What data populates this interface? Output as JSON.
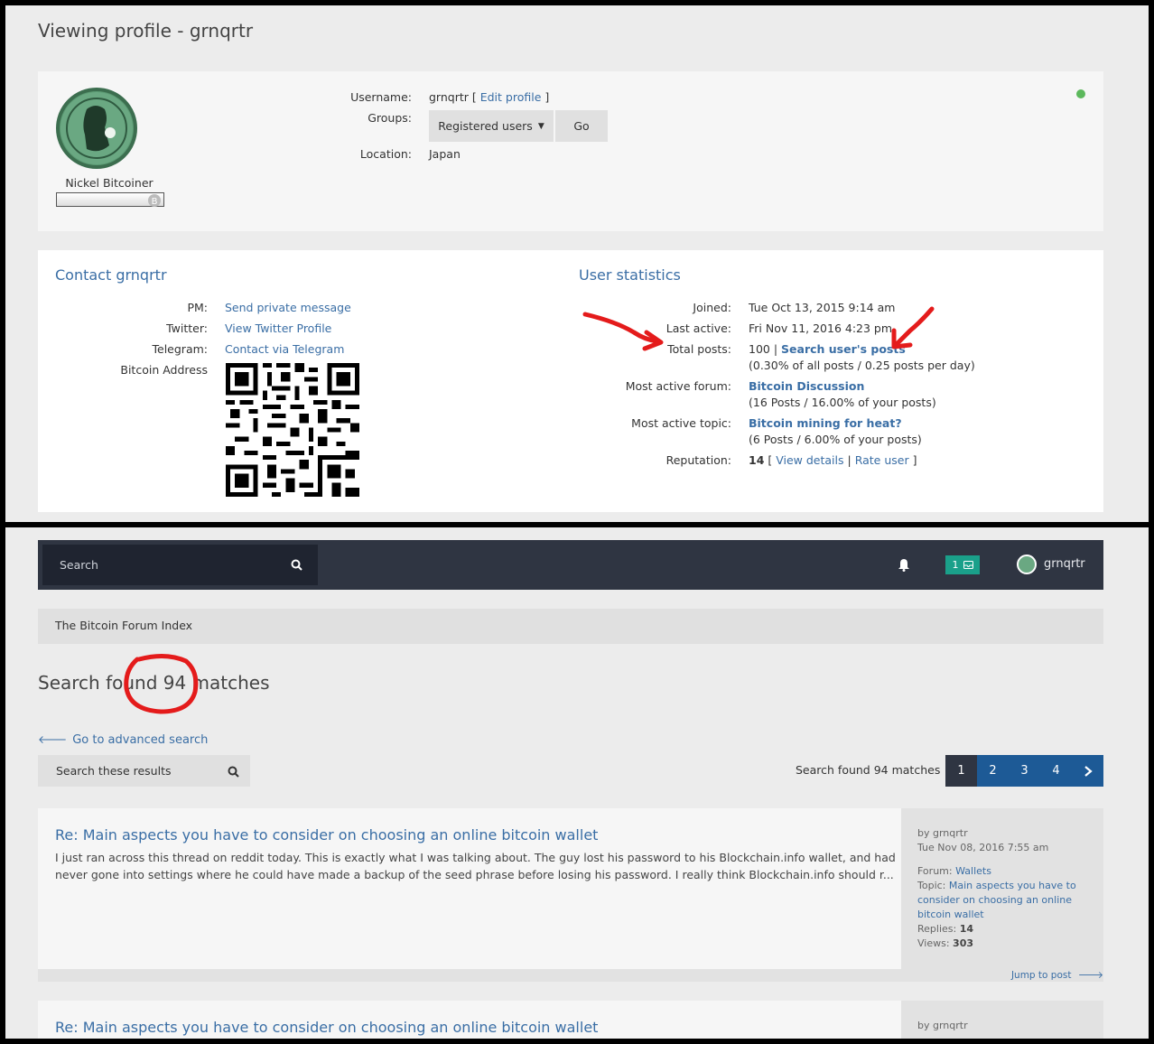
{
  "profile": {
    "title": "Viewing profile - grnqrtr",
    "rank": "Nickel Bitcoiner",
    "username_label": "Username:",
    "username": "grnqrtr",
    "edit_profile": "Edit profile",
    "groups_label": "Groups:",
    "group_selected": "Registered users",
    "go": "Go",
    "location_label": "Location:",
    "location": "Japan"
  },
  "contact": {
    "heading": "Contact grnqrtr",
    "pm_label": "PM:",
    "pm_link": "Send private message",
    "twitter_label": "Twitter:",
    "twitter_link": "View Twitter Profile",
    "telegram_label": "Telegram:",
    "telegram_link": "Contact via Telegram",
    "btc_label": "Bitcoin Address"
  },
  "stats": {
    "heading": "User statistics",
    "joined_label": "Joined:",
    "joined": "Tue Oct 13, 2015 9:14 am",
    "last_active_label": "Last active:",
    "last_active": "Fri Nov 11, 2016 4:23 pm",
    "total_posts_label": "Total posts:",
    "total_posts": "100",
    "search_posts": "Search user's posts",
    "posts_detail": "(0.30% of all posts / 0.25 posts per day)",
    "forum_label": "Most active forum:",
    "forum": "Bitcoin Discussion",
    "forum_detail": "(16 Posts / 16.00% of your posts)",
    "topic_label": "Most active topic:",
    "topic": "Bitcoin mining for heat?",
    "topic_detail": "(6 Posts / 6.00% of your posts)",
    "rep_label": "Reputation:",
    "rep": "14",
    "view_details": "View details",
    "rate_user": "Rate user"
  },
  "nav": {
    "search_placeholder": "Search",
    "notif_count": "1",
    "user": "grnqrtr",
    "breadcrumb": "The Bitcoin Forum Index"
  },
  "search": {
    "heading": "Search found 94 matches",
    "advanced": "Go to advanced search",
    "search_results_placeholder": "Search these results",
    "count_text": "Search found 94 matches",
    "pages": [
      "1",
      "2",
      "3",
      "4"
    ]
  },
  "results": [
    {
      "title": "Re: Main aspects you have to consider on choosing an online bitcoin wallet",
      "line1": "I just ran across this thread on reddit today. This is exactly what I was talking about. The guy lost his password to his Blockchain.info wallet, and had",
      "line2": "never gone into settings where he could have made a backup of the seed phrase before losing his password. I really think Blockchain.info should r...",
      "by_label": "by",
      "by": "grnqrtr",
      "date": "Tue Nov 08, 2016 7:55 am",
      "forum_label": "Forum:",
      "forum": "Wallets",
      "topic_label": "Topic:",
      "topic_1": "Main aspects you have to",
      "topic_2": "consider on choosing an online",
      "topic_3": "bitcoin wallet",
      "replies_label": "Replies:",
      "replies": "14",
      "views_label": "Views:",
      "views": "303",
      "jump": "Jump to post"
    },
    {
      "title": "Re: Main aspects you have to consider on choosing an online bitcoin wallet",
      "by_label": "by",
      "by": "grnqrtr"
    }
  ]
}
